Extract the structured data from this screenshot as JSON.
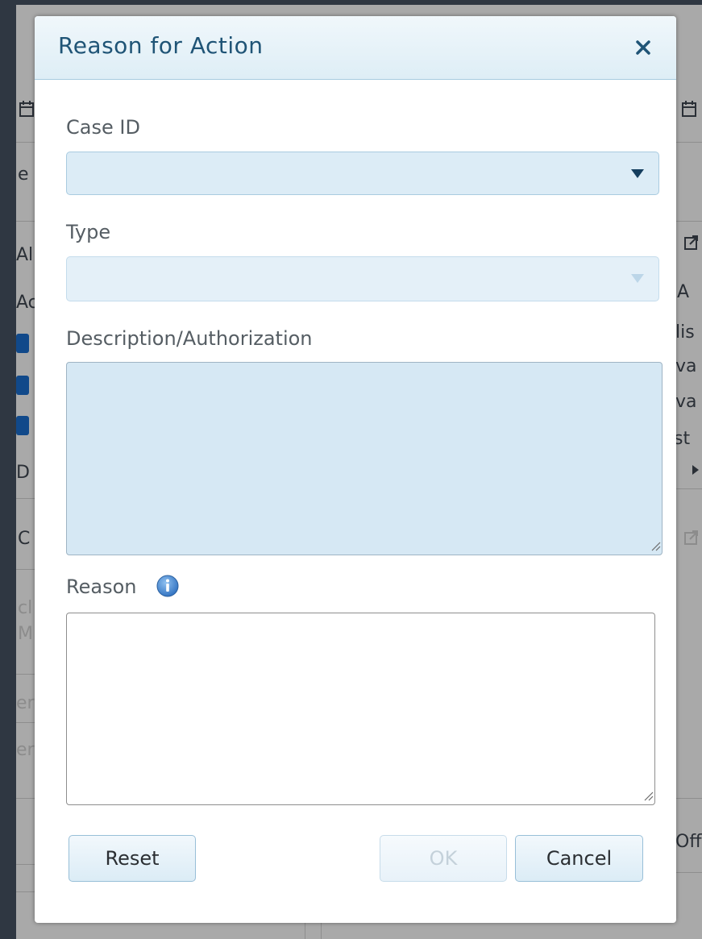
{
  "background": {
    "fragments": [
      "e",
      "Al",
      "Ac",
      "D",
      "C",
      "cl",
      "M",
      "er",
      "er",
      "A",
      "lis",
      "va",
      "va",
      "st",
      "Off"
    ]
  },
  "dialog": {
    "title": "Reason for Action",
    "close_icon": "close-icon",
    "fields": {
      "case_id": {
        "label": "Case ID",
        "value": ""
      },
      "type": {
        "label": "Type",
        "value": "",
        "disabled": true
      },
      "description": {
        "label": "Description/Authorization",
        "value": ""
      },
      "reason": {
        "label": "Reason",
        "value": "",
        "info_icon": "info-icon"
      }
    },
    "buttons": {
      "reset": "Reset",
      "ok": "OK",
      "cancel": "Cancel"
    }
  },
  "colors": {
    "header_text": "#1f5476",
    "checkbox": "#11498a",
    "info_icon": "#3b7fd0"
  }
}
